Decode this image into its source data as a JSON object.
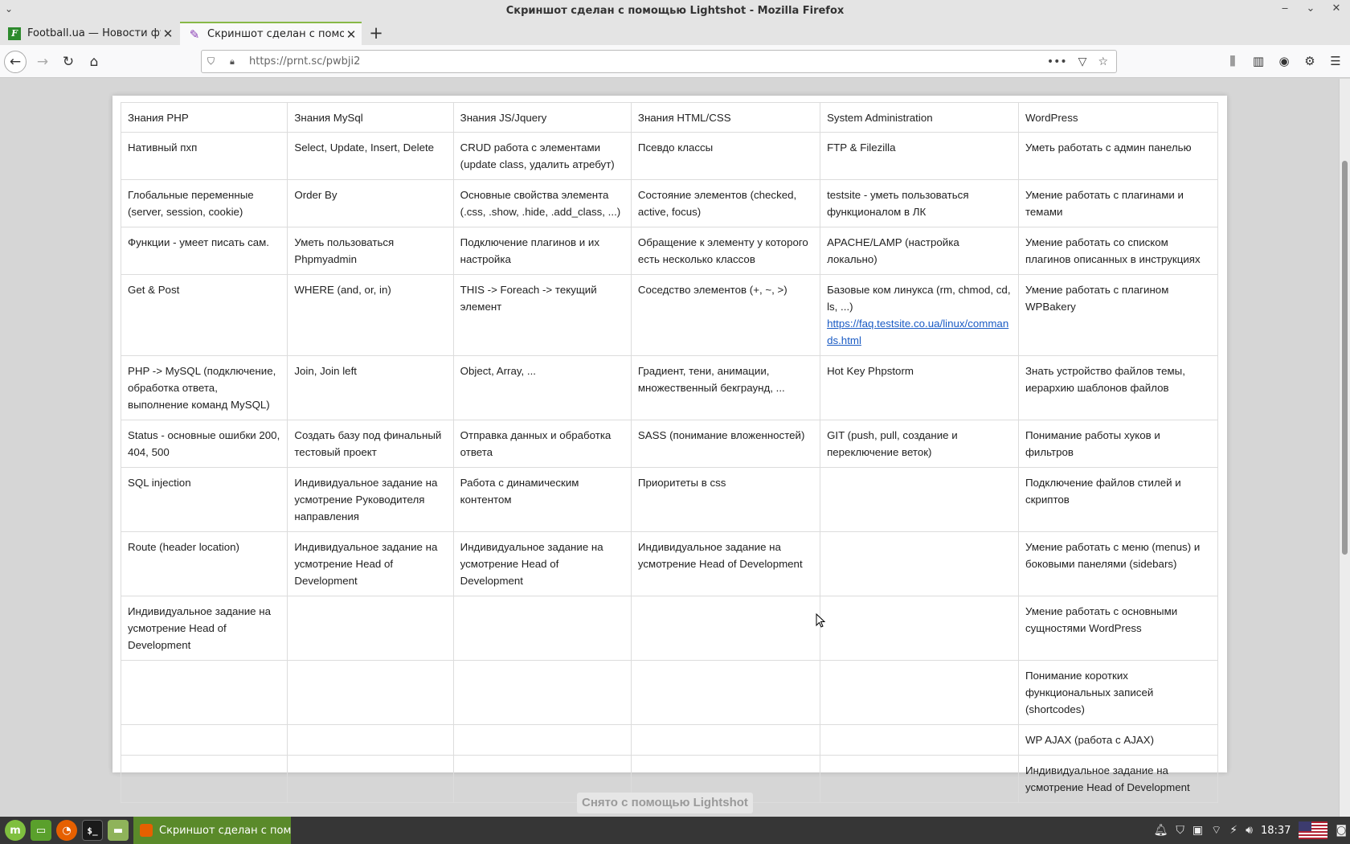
{
  "window": {
    "title": "Скриншот сделан с помощью Lightshot - Mozilla Firefox",
    "controls": [
      "‒",
      "⌄",
      "✕"
    ]
  },
  "tabs": [
    {
      "label": "Football.ua — Новости фу",
      "favicon": "football-ua-icon"
    },
    {
      "label": "Скриншот сделан с помо",
      "favicon": "lightshot-feather-icon",
      "active": true
    }
  ],
  "navbar": {
    "url_prefix": "https://prnt.sc/",
    "url_path": "pwbji2",
    "page_actions": "•••"
  },
  "table": {
    "headers": [
      "Знания PHP",
      "Знания MySql",
      "Знания JS/Jquery",
      "Знания HTML/CSS",
      "System Administration",
      "WordPress"
    ],
    "rows": [
      [
        "Нативный пхп",
        "Select, Update, Insert, Delete",
        "CRUD работа с элементами (update class, удалить атребут)",
        "Псевдо классы",
        "FTP & Filezilla",
        "Уметь работать с админ панелью"
      ],
      [
        "Глобальные переменные (server, session, cookie)",
        "Order By",
        "Основные свойства элемента (.css, .show, .hide, .add_class, ...)",
        "Состояние элементов (checked, active, focus)",
        "testsite - уметь пользоваться функционалом в ЛК",
        "Умение работать с плагинами и темами"
      ],
      [
        "Функции - умеет писать сам.",
        "Уметь пользоваться Phpmyadmin",
        "Подключение плагинов и их настройка",
        "Обращение к элементу у которого есть несколько классов",
        "APACHE/LAMP (настройка локально)",
        "Умение работать со списком плагинов описанных в инструкциях"
      ],
      [
        "Get & Post",
        "WHERE (and, or, in)",
        "THIS -> Foreach -> текущий элемент",
        "Соседство элементов (+, ~, >)",
        "Базовые ком линукса (rm, chmod, cd, ls, ...)",
        "Умение работать с плагином WPBakery"
      ],
      [
        "PHP -> MySQL (подключение, обработка ответа, выполнение команд MySQL)",
        "Join, Join left",
        "Object, Array, ...",
        "Градиент, тени, анимации, множественный бекграунд, ...",
        "Hot Key Phpstorm",
        "Знать устройство файлов темы, иерархию шаблонов файлов"
      ],
      [
        "Status - основные ошибки 200, 404, 500",
        "Создать базу под финальный тестовый проект",
        "Отправка данных и обработка ответа",
        "SASS (понимание вложенностей)",
        "GIT (push, pull, создание и переключение веток)",
        "Понимание работы хуков и фильтров"
      ],
      [
        "SQL injection",
        "Индивидуальное задание на усмотрение Руководителя направления",
        "Работа с динамическим контентом",
        "Приоритеты в css",
        "",
        "Подключение файлов стилей и скриптов"
      ],
      [
        "Route (header location)",
        "Индивидуальное задание на усмотрение Head of Development",
        "Индивидуальное задание на усмотрение Head of Development",
        "Индивидуальное задание на усмотрение Head of Development",
        "",
        "Умение работать с меню (menus) и боковыми панелями (sidebars)"
      ],
      [
        "Индивидуальное задание на усмотрение Head of Development",
        "",
        "",
        "",
        "",
        "Умение работать с основными сущностями WordPress"
      ],
      [
        "",
        "",
        "",
        "",
        "",
        "Понимание коротких функциональных записей (shortcodes)"
      ],
      [
        "",
        "",
        "",
        "",
        "",
        "WP AJAX (работа с AJAX)"
      ],
      [
        "",
        "",
        "",
        "",
        "",
        "Индивидуальное задание на усмотрение Head of Development"
      ]
    ],
    "link_cell_link": "https://faq.testsite.co.ua/linux/commands.html"
  },
  "footer_caption": "Снято с помощью Lightshot",
  "taskbar": {
    "window_label": "Скриншот сделан с помо...",
    "clock": "18:37",
    "term_glyph": "$_"
  }
}
